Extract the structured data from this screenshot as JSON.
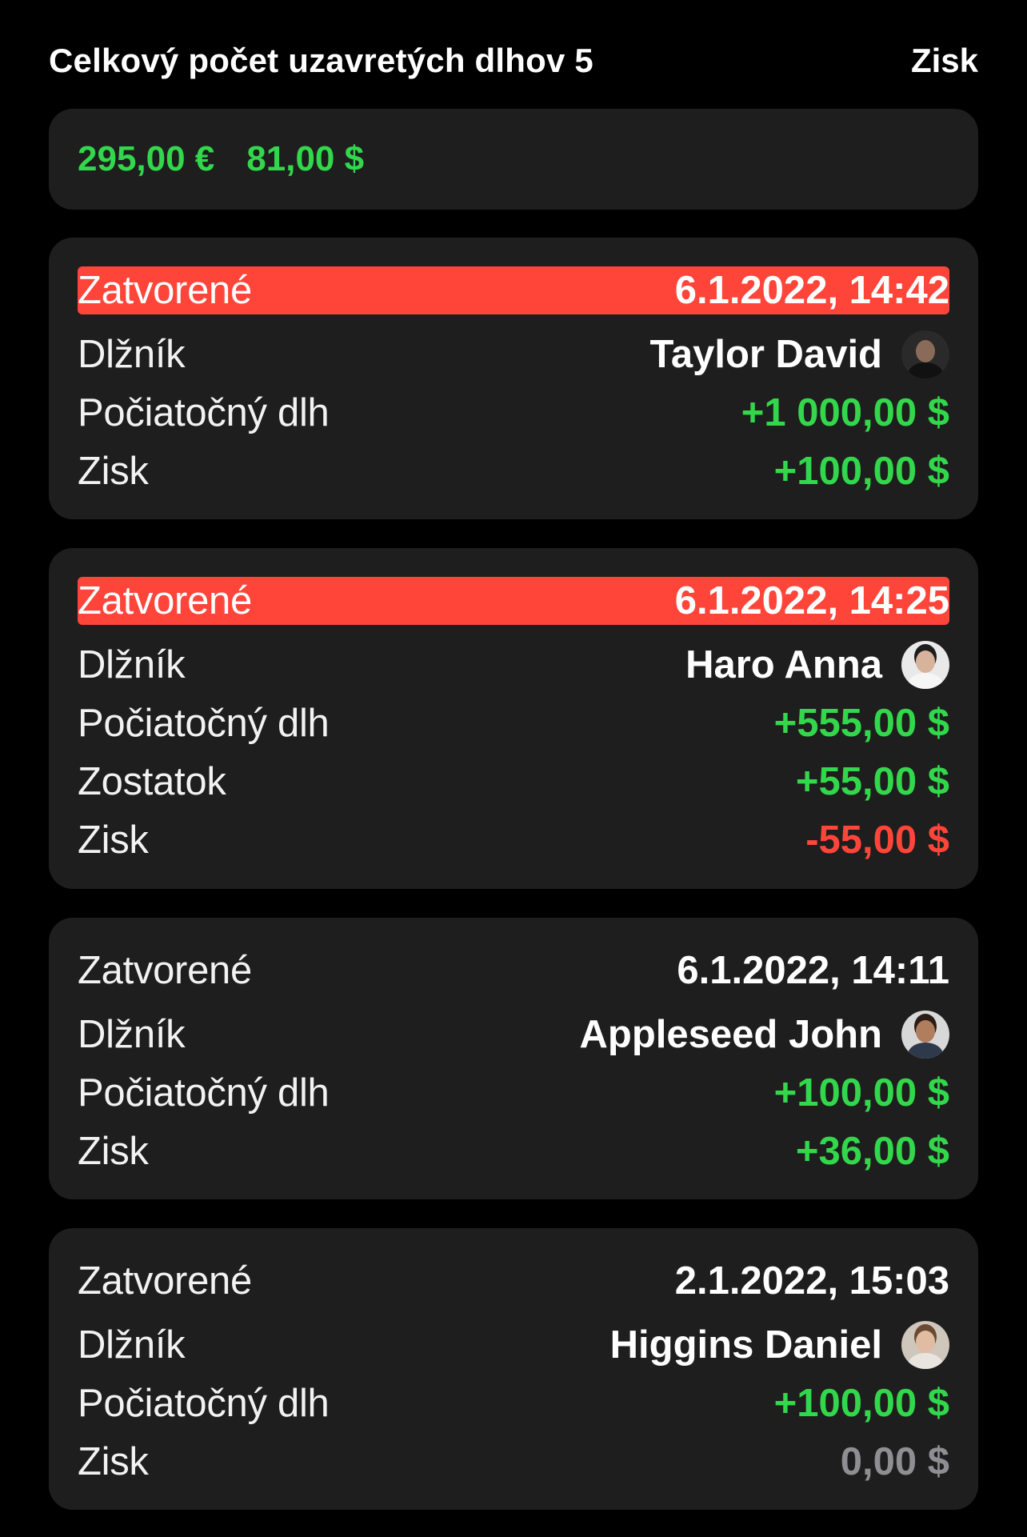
{
  "header": {
    "title": "Celkový počet uzavretých dlhov 5",
    "action": "Zisk"
  },
  "summary": {
    "eur": "295,00 €",
    "usd": "81,00 $"
  },
  "colors": {
    "positive": "#32d74b",
    "negative": "#ff453a",
    "neutral": "#8e8e93",
    "highlight": "#ff453a",
    "card": "#1e1e1e"
  },
  "debts": [
    {
      "closed_label": "Zatvorené",
      "closed_date": "6.1.2022, 14:42",
      "debtor_label": "Dlžník",
      "debtor_name": "Taylor David",
      "avatar_icon": "person-avatar-icon",
      "initial_label": "Počiatočný dlh",
      "initial_value": "+1 000,00 $",
      "profit_label": "Zisk",
      "profit_value": "+100,00 $",
      "highlighted": true
    },
    {
      "closed_label": "Zatvorené",
      "closed_date": "6.1.2022, 14:25",
      "debtor_label": "Dlžník",
      "debtor_name": "Haro Anna",
      "avatar_icon": "person-avatar-icon",
      "initial_label": "Počiatočný dlh",
      "initial_value": "+555,00 $",
      "remaining_label": "Zostatok",
      "remaining_value": "+55,00 $",
      "profit_label": "Zisk",
      "profit_value": "-55,00 $",
      "highlighted": true
    },
    {
      "closed_label": "Zatvorené",
      "closed_date": "6.1.2022, 14:11",
      "debtor_label": "Dlžník",
      "debtor_name": "Appleseed John",
      "avatar_icon": "person-avatar-icon",
      "initial_label": "Počiatočný dlh",
      "initial_value": "+100,00 $",
      "profit_label": "Zisk",
      "profit_value": "+36,00 $",
      "highlighted": false
    },
    {
      "closed_label": "Zatvorené",
      "closed_date": "2.1.2022, 15:03",
      "debtor_label": "Dlžník",
      "debtor_name": "Higgins Daniel",
      "avatar_icon": "person-avatar-icon",
      "initial_label": "Počiatočný dlh",
      "initial_value": "+100,00 $",
      "profit_label": "Zisk",
      "profit_value": "0,00 $",
      "highlighted": false
    }
  ]
}
